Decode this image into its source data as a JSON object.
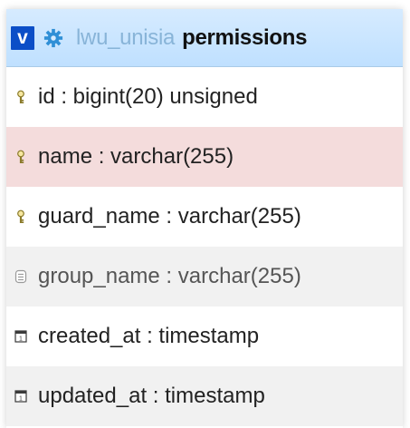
{
  "header": {
    "toggle_label": "v",
    "database": "lwu_unisia",
    "table": "permissions"
  },
  "columns": [
    {
      "label": "id : bigint(20) unsigned",
      "icon": "key-icon"
    },
    {
      "label": "name : varchar(255)",
      "icon": "key-icon"
    },
    {
      "label": "guard_name : varchar(255)",
      "icon": "key-icon"
    },
    {
      "label": "group_name : varchar(255)",
      "icon": "index-icon"
    },
    {
      "label": "created_at : timestamp",
      "icon": "timestamp-icon"
    },
    {
      "label": "updated_at : timestamp",
      "icon": "timestamp-icon"
    }
  ],
  "colors": {
    "header_bg": "#bfe0ff",
    "toggle_bg": "#0b4ec7",
    "highlight_row": "#f4dcdc",
    "alt_row": "#f1f1f1"
  }
}
